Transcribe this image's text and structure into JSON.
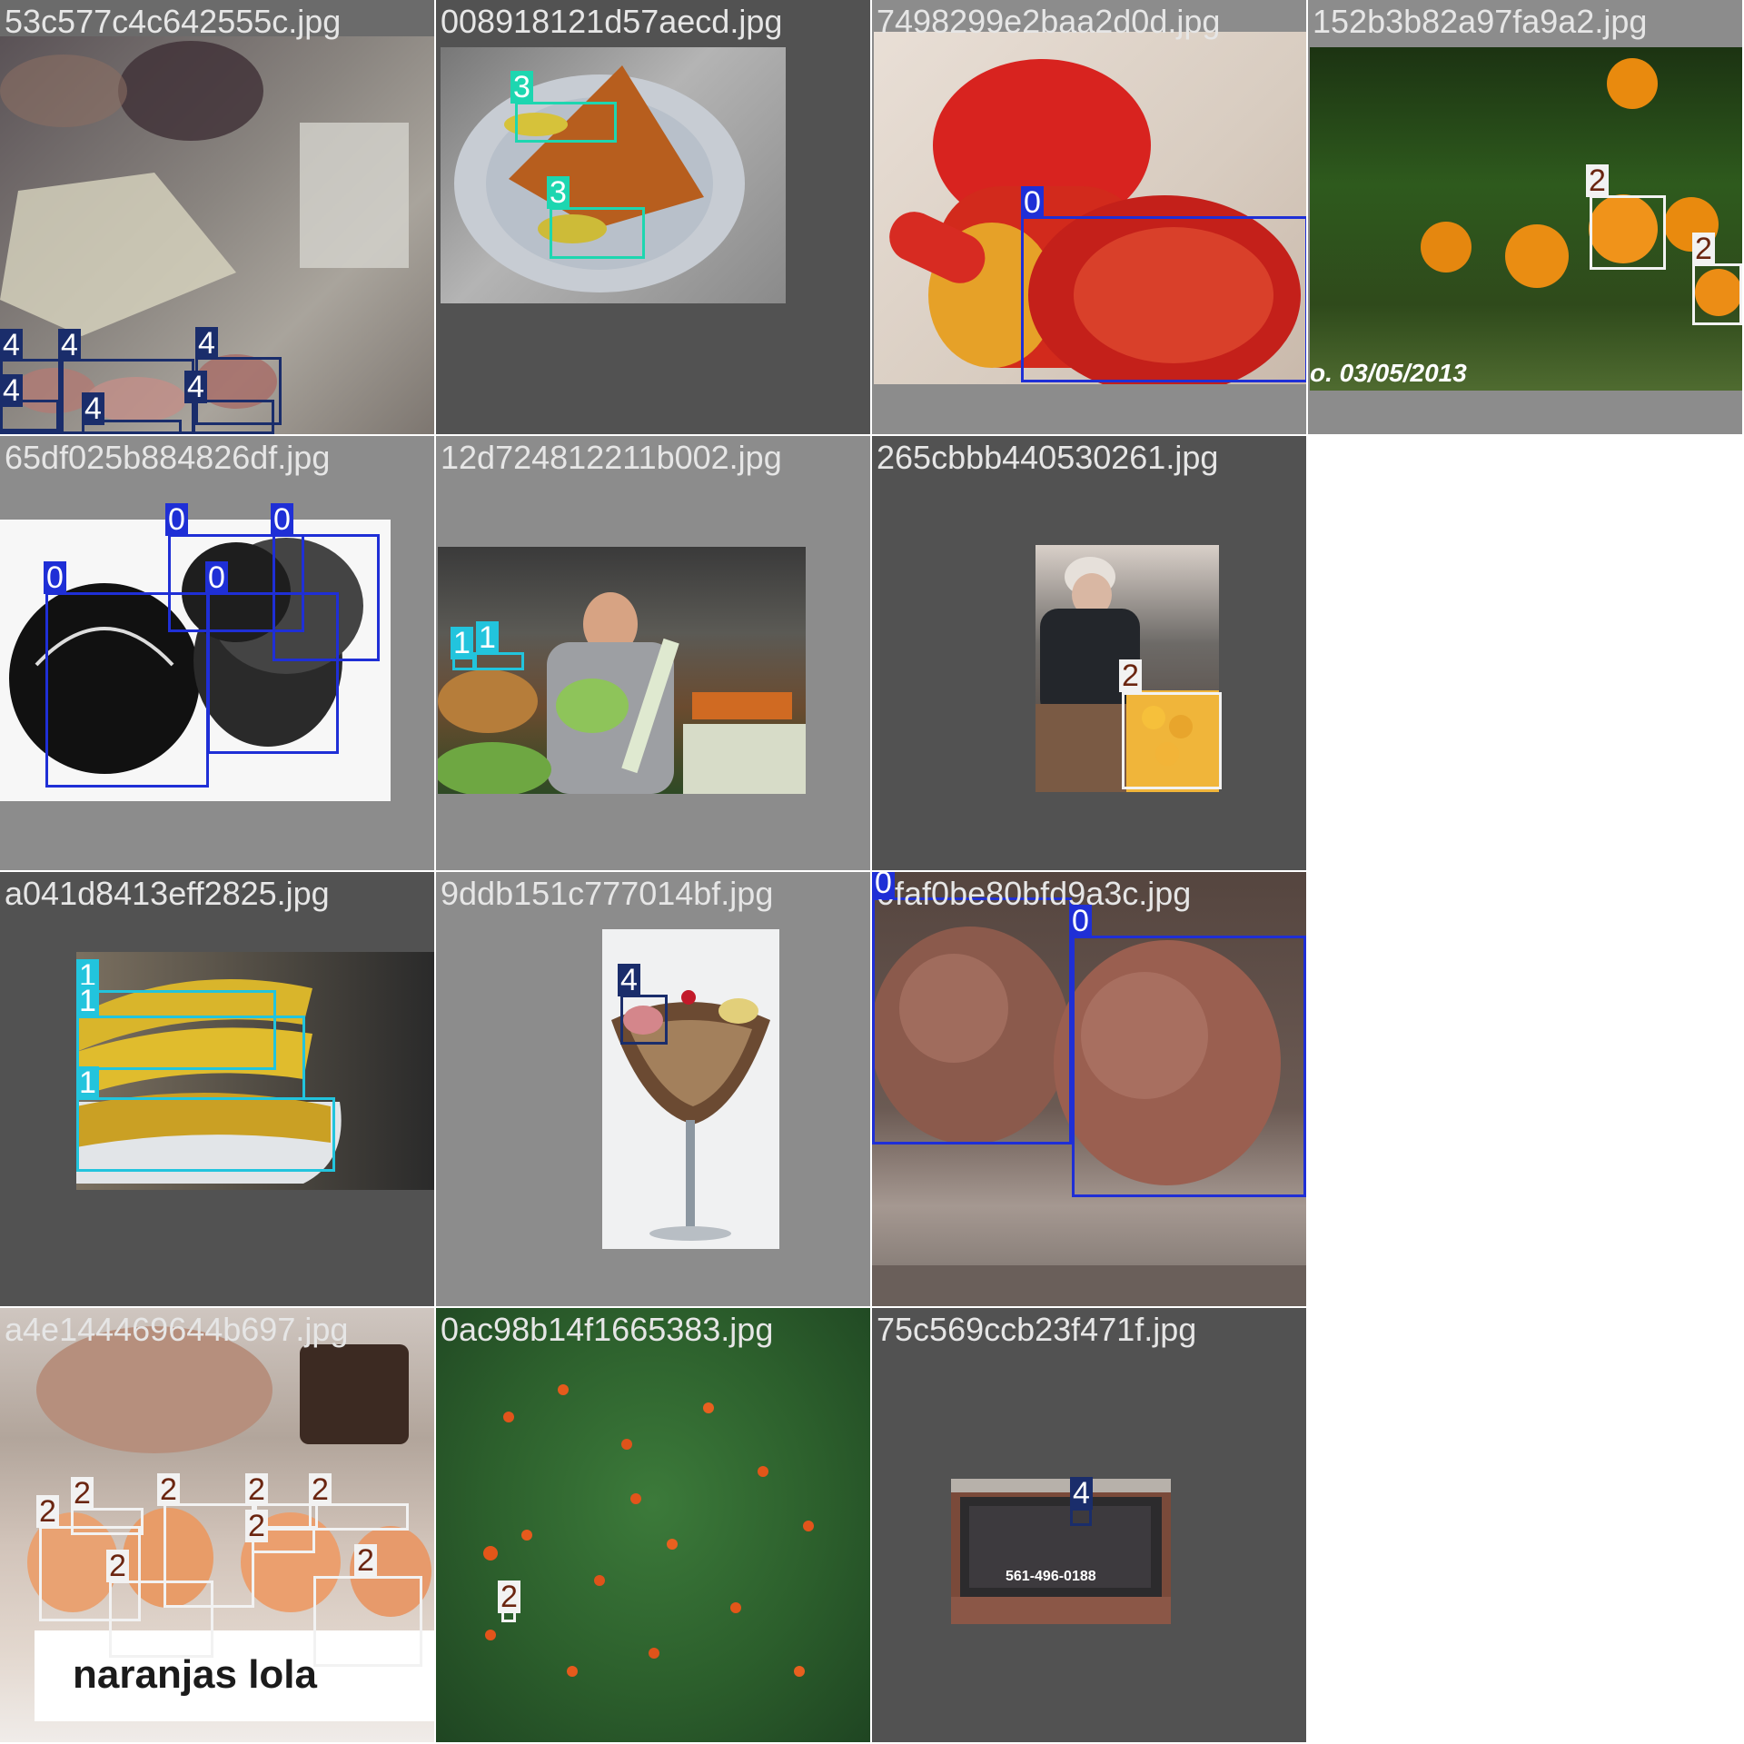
{
  "colors": {
    "class_0": "#1f2fd6",
    "class_1": "#22c4dd",
    "class_2": "#f2f2f2",
    "class_3": "#1dd6b0",
    "class_4": "#1a2d6b",
    "tile_dark": "#525252",
    "tile_light": "#8c8c8c",
    "page_bg": "#ffffff"
  },
  "tiles": [
    {
      "filename": "53c577c4c642555c.jpg",
      "labels": [
        "4",
        "4",
        "4",
        "4",
        "4",
        "4"
      ]
    },
    {
      "filename": "008918121d57aecd.jpg",
      "labels": [
        "3",
        "3"
      ]
    },
    {
      "filename": "7498299e2baa2d0d.jpg",
      "labels": [
        "0"
      ]
    },
    {
      "filename": "152b3b82a97fa9a2.jpg",
      "labels": [
        "2",
        "2"
      ],
      "overlay_text": "o. 03/05/2013"
    },
    {
      "filename": "65df025b884826df.jpg",
      "labels": [
        "0",
        "0",
        "0",
        "0"
      ]
    },
    {
      "filename": "12d724812211b002.jpg",
      "labels": [
        "1",
        "1"
      ]
    },
    {
      "filename": "265cbbb440530261.jpg",
      "labels": [
        "2"
      ]
    },
    {
      "filename": "a041d8413eff2825.jpg",
      "labels": [
        "1",
        "1",
        "1"
      ]
    },
    {
      "filename": "9ddb151c777014bf.jpg",
      "labels": [
        "4"
      ]
    },
    {
      "filename": "0faf0be80bfd9a3c.jpg",
      "labels": [
        "0",
        "0"
      ]
    },
    {
      "filename": "a4e144469644b697.jpg",
      "labels": [
        "2",
        "2",
        "2",
        "2",
        "2",
        "2",
        "2",
        "2"
      ],
      "overlay_text": "naranjas lola"
    },
    {
      "filename": "0ac98b14f1665383.jpg",
      "labels": [
        "2"
      ]
    },
    {
      "filename": "75c569ccb23f471f.jpg",
      "labels": [
        "4"
      ],
      "overlay_text": "561-496-0188"
    }
  ]
}
